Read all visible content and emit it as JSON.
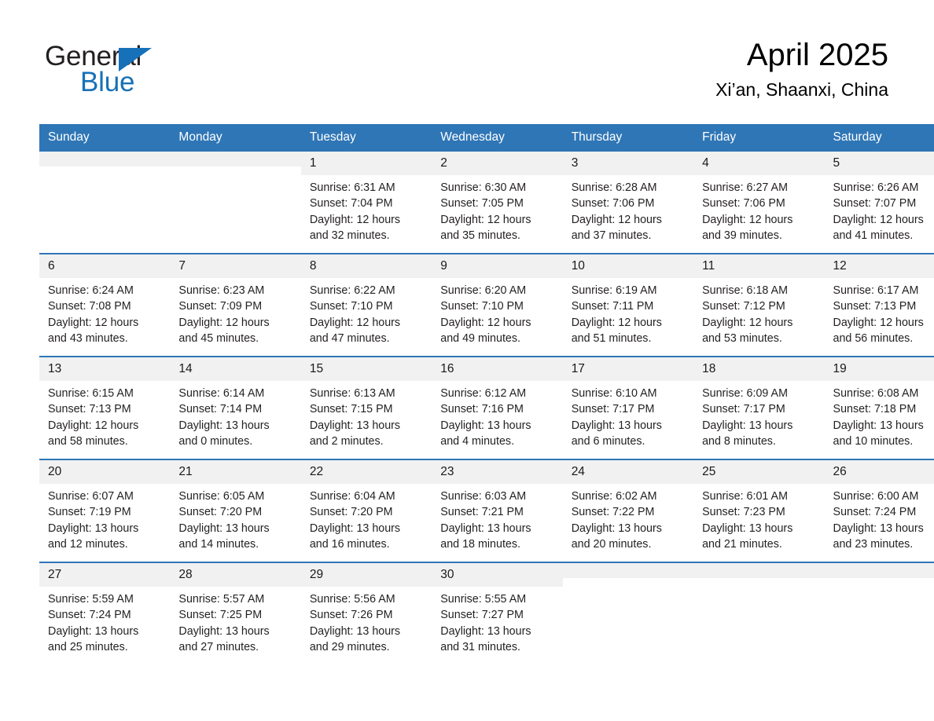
{
  "logo": {
    "part1": "General",
    "part2": "Blue",
    "triangle_color": "#1771b8"
  },
  "header": {
    "month_title": "April 2025",
    "location": "Xi’an, Shaanxi, China",
    "accent_color": "#2f76b6",
    "daynum_band_color": "#f1f1f1"
  },
  "weekday_headers": [
    "Sunday",
    "Monday",
    "Tuesday",
    "Wednesday",
    "Thursday",
    "Friday",
    "Saturday"
  ],
  "weeks": [
    [
      {
        "day": "",
        "details": "",
        "blank": true
      },
      {
        "day": "",
        "details": "",
        "blank": true
      },
      {
        "day": "1",
        "details": "Sunrise: 6:31 AM\nSunset: 7:04 PM\nDaylight: 12 hours\nand 32 minutes."
      },
      {
        "day": "2",
        "details": "Sunrise: 6:30 AM\nSunset: 7:05 PM\nDaylight: 12 hours\nand 35 minutes."
      },
      {
        "day": "3",
        "details": "Sunrise: 6:28 AM\nSunset: 7:06 PM\nDaylight: 12 hours\nand 37 minutes."
      },
      {
        "day": "4",
        "details": "Sunrise: 6:27 AM\nSunset: 7:06 PM\nDaylight: 12 hours\nand 39 minutes."
      },
      {
        "day": "5",
        "details": "Sunrise: 6:26 AM\nSunset: 7:07 PM\nDaylight: 12 hours\nand 41 minutes."
      }
    ],
    [
      {
        "day": "6",
        "details": "Sunrise: 6:24 AM\nSunset: 7:08 PM\nDaylight: 12 hours\nand 43 minutes."
      },
      {
        "day": "7",
        "details": "Sunrise: 6:23 AM\nSunset: 7:09 PM\nDaylight: 12 hours\nand 45 minutes."
      },
      {
        "day": "8",
        "details": "Sunrise: 6:22 AM\nSunset: 7:10 PM\nDaylight: 12 hours\nand 47 minutes."
      },
      {
        "day": "9",
        "details": "Sunrise: 6:20 AM\nSunset: 7:10 PM\nDaylight: 12 hours\nand 49 minutes."
      },
      {
        "day": "10",
        "details": "Sunrise: 6:19 AM\nSunset: 7:11 PM\nDaylight: 12 hours\nand 51 minutes."
      },
      {
        "day": "11",
        "details": "Sunrise: 6:18 AM\nSunset: 7:12 PM\nDaylight: 12 hours\nand 53 minutes."
      },
      {
        "day": "12",
        "details": "Sunrise: 6:17 AM\nSunset: 7:13 PM\nDaylight: 12 hours\nand 56 minutes."
      }
    ],
    [
      {
        "day": "13",
        "details": "Sunrise: 6:15 AM\nSunset: 7:13 PM\nDaylight: 12 hours\nand 58 minutes."
      },
      {
        "day": "14",
        "details": "Sunrise: 6:14 AM\nSunset: 7:14 PM\nDaylight: 13 hours\nand 0 minutes."
      },
      {
        "day": "15",
        "details": "Sunrise: 6:13 AM\nSunset: 7:15 PM\nDaylight: 13 hours\nand 2 minutes."
      },
      {
        "day": "16",
        "details": "Sunrise: 6:12 AM\nSunset: 7:16 PM\nDaylight: 13 hours\nand 4 minutes."
      },
      {
        "day": "17",
        "details": "Sunrise: 6:10 AM\nSunset: 7:17 PM\nDaylight: 13 hours\nand 6 minutes."
      },
      {
        "day": "18",
        "details": "Sunrise: 6:09 AM\nSunset: 7:17 PM\nDaylight: 13 hours\nand 8 minutes."
      },
      {
        "day": "19",
        "details": "Sunrise: 6:08 AM\nSunset: 7:18 PM\nDaylight: 13 hours\nand 10 minutes."
      }
    ],
    [
      {
        "day": "20",
        "details": "Sunrise: 6:07 AM\nSunset: 7:19 PM\nDaylight: 13 hours\nand 12 minutes."
      },
      {
        "day": "21",
        "details": "Sunrise: 6:05 AM\nSunset: 7:20 PM\nDaylight: 13 hours\nand 14 minutes."
      },
      {
        "day": "22",
        "details": "Sunrise: 6:04 AM\nSunset: 7:20 PM\nDaylight: 13 hours\nand 16 minutes."
      },
      {
        "day": "23",
        "details": "Sunrise: 6:03 AM\nSunset: 7:21 PM\nDaylight: 13 hours\nand 18 minutes."
      },
      {
        "day": "24",
        "details": "Sunrise: 6:02 AM\nSunset: 7:22 PM\nDaylight: 13 hours\nand 20 minutes."
      },
      {
        "day": "25",
        "details": "Sunrise: 6:01 AM\nSunset: 7:23 PM\nDaylight: 13 hours\nand 21 minutes."
      },
      {
        "day": "26",
        "details": "Sunrise: 6:00 AM\nSunset: 7:24 PM\nDaylight: 13 hours\nand 23 minutes."
      }
    ],
    [
      {
        "day": "27",
        "details": "Sunrise: 5:59 AM\nSunset: 7:24 PM\nDaylight: 13 hours\nand 25 minutes."
      },
      {
        "day": "28",
        "details": "Sunrise: 5:57 AM\nSunset: 7:25 PM\nDaylight: 13 hours\nand 27 minutes."
      },
      {
        "day": "29",
        "details": "Sunrise: 5:56 AM\nSunset: 7:26 PM\nDaylight: 13 hours\nand 29 minutes."
      },
      {
        "day": "30",
        "details": "Sunrise: 5:55 AM\nSunset: 7:27 PM\nDaylight: 13 hours\nand 31 minutes."
      },
      {
        "day": "",
        "details": "",
        "blank": true
      },
      {
        "day": "",
        "details": "",
        "blank": true
      },
      {
        "day": "",
        "details": "",
        "blank": true
      }
    ]
  ]
}
